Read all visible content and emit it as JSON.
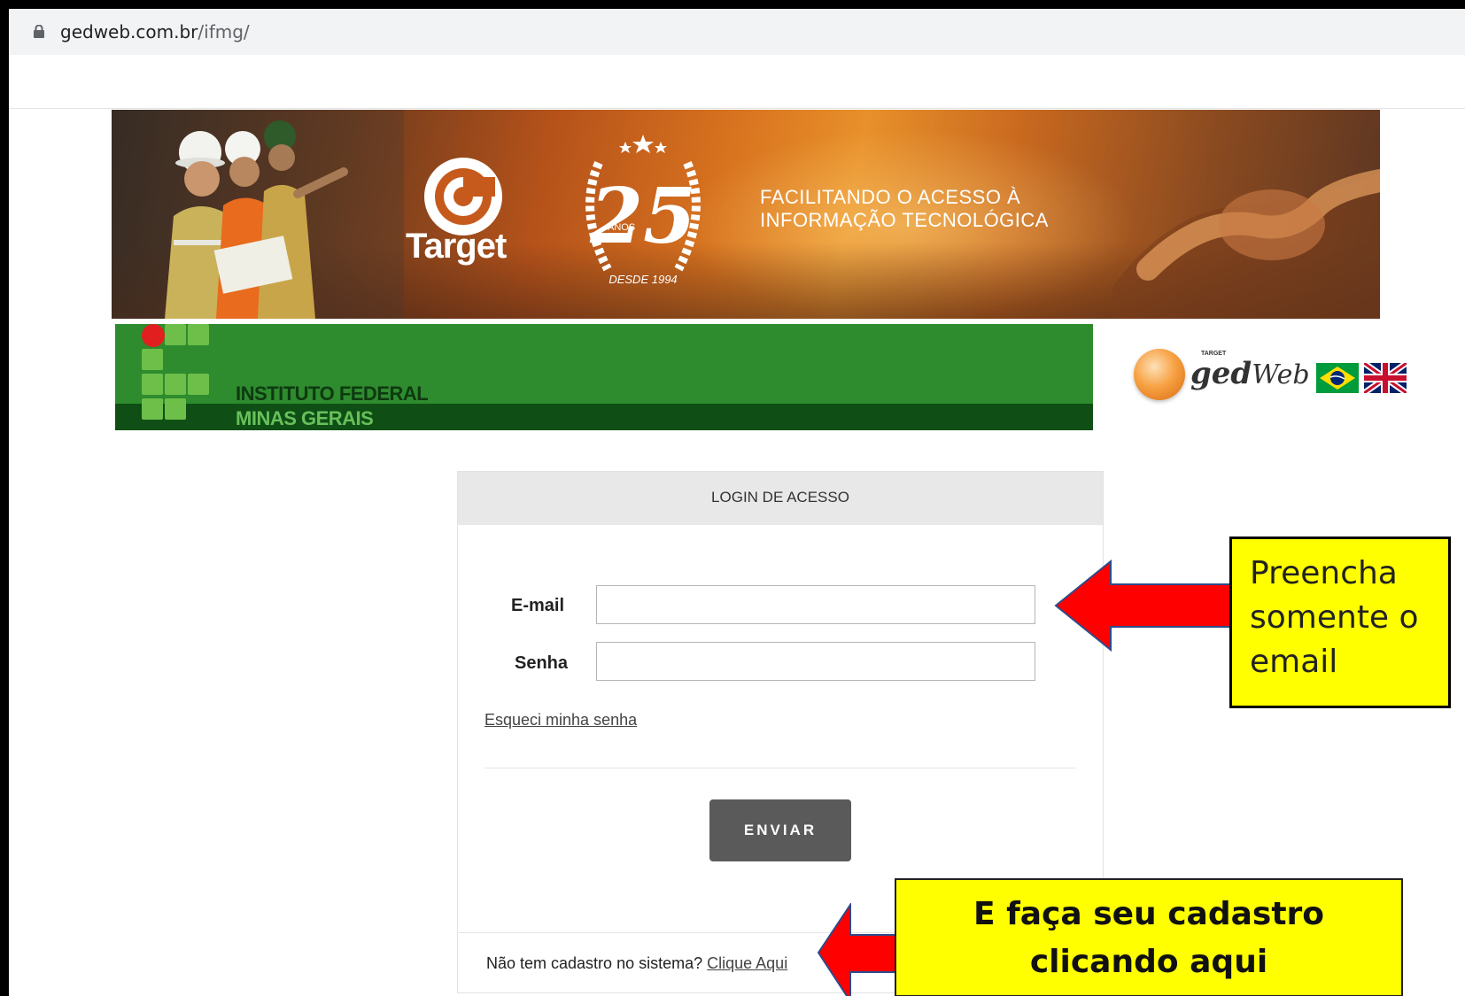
{
  "browser": {
    "url_host": "gedweb.com.br",
    "url_path": "/ifmg/"
  },
  "banner": {
    "brand": "Target",
    "anniversary_number": "25",
    "anniversary_unit": "ANOS",
    "anniversary_since": "DESDE 1994",
    "tagline_line1": "FACILITANDO O ACESSO À",
    "tagline_line2": "INFORMAÇÃO TECNOLÓGICA"
  },
  "institution": {
    "name_line1": "INSTITUTO FEDERAL",
    "name_line2": "MINAS GERAIS"
  },
  "gedweb": {
    "small_label": "TARGET",
    "name_bold": "ged",
    "name_light": "Web",
    "languages": [
      "pt-BR",
      "en-GB"
    ]
  },
  "login": {
    "title": "LOGIN DE ACESSO",
    "email_label": "E-mail",
    "email_value": "",
    "password_label": "Senha",
    "password_value": "",
    "forgot_link": "Esqueci minha senha",
    "submit_label": "ENVIAR",
    "register_prompt": "Não tem cadastro no sistema? ",
    "register_link": "Clique Aqui"
  },
  "annotations": {
    "callout1_line1": "Preencha",
    "callout1_line2": "somente o",
    "callout1_line3": "email",
    "callout2_line1": "E faça seu cadastro",
    "callout2_line2": "clicando aqui",
    "arrow_color": "#ff0000",
    "callout_color": "#ffff00"
  }
}
